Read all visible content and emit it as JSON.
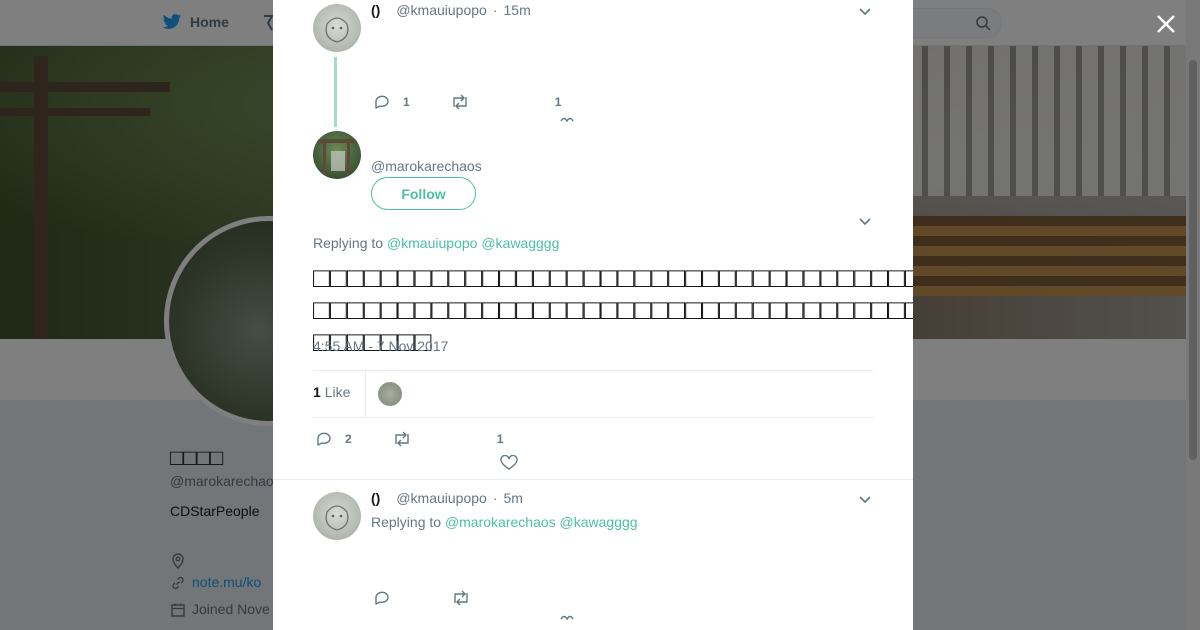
{
  "nav": {
    "home_label": "Home"
  },
  "profile": {
    "name": "□□□□",
    "handle": "@marokarechaos",
    "bio": "CDStarPeople",
    "link": "note.mu/ko",
    "joined": "Joined Nove"
  },
  "tweets": [
    {
      "name": "()",
      "handle": "@kmauiupopo",
      "time": "15m",
      "replies": "1",
      "likes": "1"
    },
    {
      "handle": "@marokarechaos",
      "follow_label": "Follow",
      "replying_prefix": "Replying to",
      "mentions": [
        "@kmauiupopo",
        "@kawagggg"
      ],
      "text": "□□□□□□□□□□□□□□□□□□□□□□□□□□□□□□□□□□□□□□□□□□□□□□□□□□□□□□□□□□□□□□□□□□□□□□□□□□□□□□□□□□□□□□□□□□□□□□□□□□□□□□□□□□□□□",
      "timestamp": "4:55 AM - 7 Nov 2017",
      "like_count": "1",
      "like_label": "Like",
      "replies": "2",
      "likes": "1"
    },
    {
      "name": "()",
      "handle": "@kmauiupopo",
      "time": "5m",
      "replying_prefix": "Replying to",
      "mentions": [
        "@marokarechaos",
        "@kawagggg"
      ]
    }
  ],
  "colors": {
    "accent": "#4cc0a1",
    "link": "#1da1f2",
    "muted": "#657786",
    "twitter_blue": "#1da1f2"
  },
  "icons": [
    "twitter-bird-icon",
    "search-icon",
    "close-icon",
    "chevron-down-icon",
    "reply-icon",
    "retweet-icon",
    "heart-icon",
    "location-icon",
    "link-icon",
    "calendar-icon"
  ]
}
